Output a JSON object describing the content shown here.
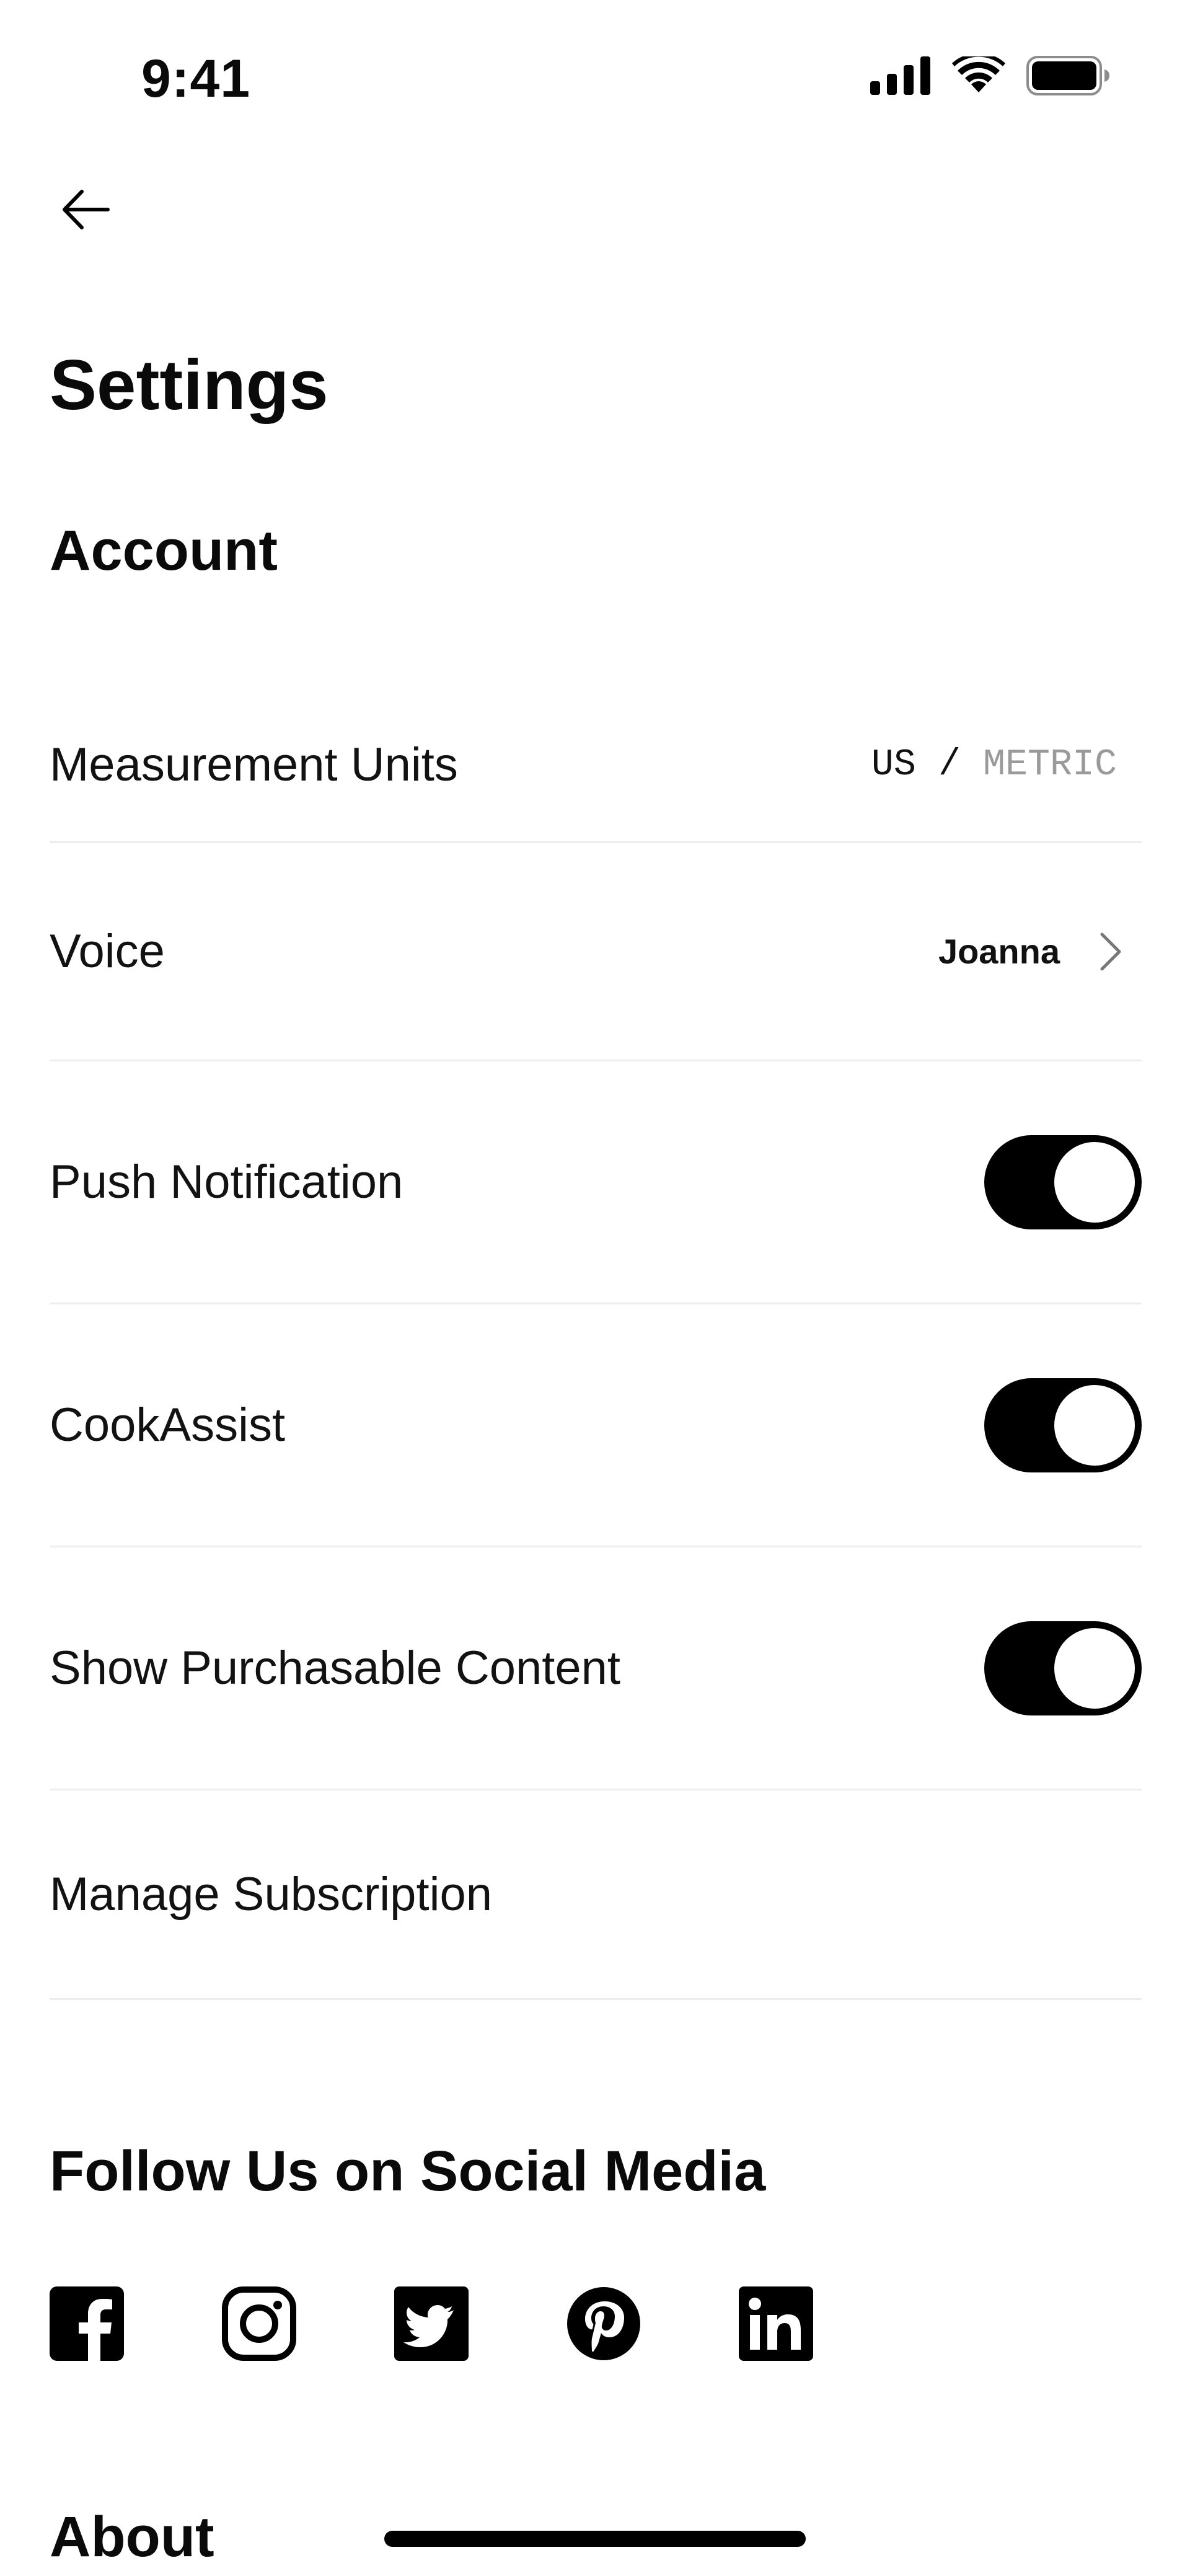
{
  "status_bar": {
    "time": "9:41"
  },
  "header": {
    "title": "Settings"
  },
  "account": {
    "title": "Account",
    "measurement_units": {
      "label": "Measurement Units",
      "option_us": "US",
      "separator": "/",
      "option_metric": "METRIC",
      "selected": "US"
    },
    "voice": {
      "label": "Voice",
      "value": "Joanna"
    },
    "push_notification": {
      "label": "Push Notification",
      "enabled": true
    },
    "cook_assist": {
      "label": "CookAssist",
      "enabled": true
    },
    "purchasable_content": {
      "label": "Show Purchasable Content",
      "enabled": true
    },
    "manage_subscription": {
      "label": "Manage Subscription"
    }
  },
  "social": {
    "title": "Follow Us on Social Media",
    "icons": [
      "facebook-icon",
      "instagram-icon",
      "twitter-icon",
      "pinterest-icon",
      "linkedin-icon"
    ]
  },
  "about": {
    "title": "About"
  },
  "colors": {
    "accent": "#000000",
    "divider": "#ececec",
    "inactive_text": "#9a9a9a"
  }
}
